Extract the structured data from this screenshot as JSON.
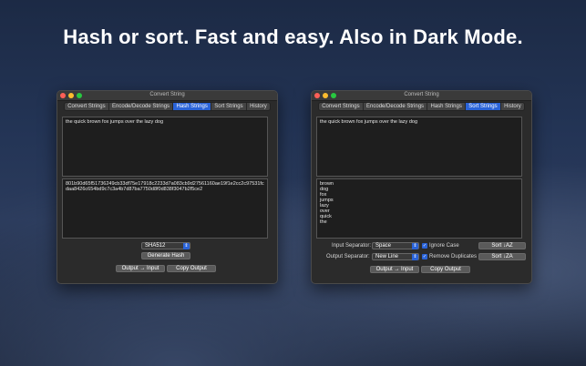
{
  "headline": "Hash or sort. Fast and easy. Also in Dark Mode.",
  "window_title": "Convert String",
  "tabs": [
    "Convert Strings",
    "Encode/Decode Strings",
    "Hash Strings",
    "Sort Strings",
    "History"
  ],
  "hash_window": {
    "active_tab": "Hash Strings",
    "input_text": "the quick brown fox jumps over the lazy dog",
    "output_text": "801b90d65f51736249cb33df75e17918c2233d7a083cb9d27561160ae19f1e2cc2c97531fcdaa8426c654bd9c7c3a4b7d87ba7750d8f0d838f3047b2f5ce2",
    "algorithm": "SHA512",
    "generate_label": "Generate Hash",
    "output_to_input_label": "Output → Input",
    "copy_output_label": "Copy Output"
  },
  "sort_window": {
    "active_tab": "Sort Strings",
    "input_text": "the quick brown fox jumps over the lazy dog",
    "output_lines": [
      "brown",
      "dog",
      "fox",
      "jumps",
      "lazy",
      "over",
      "quick",
      "the"
    ],
    "input_separator_label": "Input Separator:",
    "input_separator_value": "Space",
    "output_separator_label": "Output Separator:",
    "output_separator_value": "New Line",
    "ignore_case_label": "Ignore Case",
    "remove_duplicates_label": "Remove Duplicates",
    "sort_az_label": "Sort ↓AZ",
    "sort_za_label": "Sort ↓ZA",
    "output_to_input_label": "Output → Input",
    "copy_output_label": "Copy Output"
  }
}
